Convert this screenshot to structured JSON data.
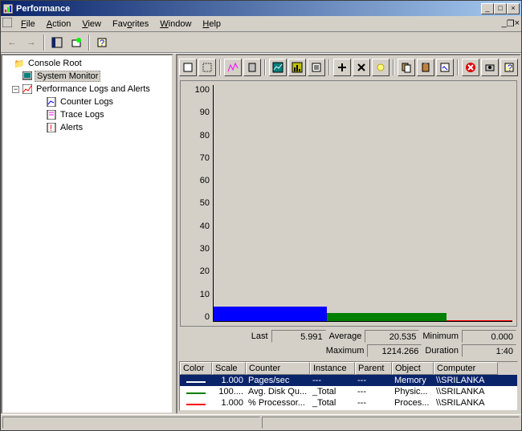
{
  "window": {
    "title": "Performance"
  },
  "menu": {
    "file": "File",
    "action": "Action",
    "view": "View",
    "favorites": "Favorites",
    "window": "Window",
    "help": "Help"
  },
  "tree": {
    "root": "Console Root",
    "system_monitor": "System Monitor",
    "perf_logs": "Performance Logs and Alerts",
    "counter_logs": "Counter Logs",
    "trace_logs": "Trace Logs",
    "alerts": "Alerts"
  },
  "chart_data": {
    "type": "bar",
    "ylim": [
      0,
      100
    ],
    "yticks": [
      "100",
      "90",
      "80",
      "70",
      "60",
      "50",
      "40",
      "30",
      "20",
      "10",
      "0"
    ],
    "series": [
      {
        "name": "Pages/sec",
        "color": "#0000ff",
        "approx_pct": 6,
        "x_start": 0,
        "x_width": 38
      },
      {
        "name": "Avg. Disk Queue Length",
        "color": "#008000",
        "approx_pct": 3.5,
        "x_start": 38,
        "x_width": 40
      },
      {
        "name": "% Processor Time",
        "color": "#ff0000",
        "approx_pct": 0.5,
        "x_start": 78,
        "x_width": 22
      }
    ]
  },
  "stats": {
    "last_label": "Last",
    "last": "5.991",
    "average_label": "Average",
    "average": "20.535",
    "minimum_label": "Minimum",
    "minimum": "0.000",
    "maximum_label": "Maximum",
    "maximum": "1214.266",
    "duration_label": "Duration",
    "duration": "1:40"
  },
  "counter_headers": {
    "color": "Color",
    "scale": "Scale",
    "counter": "Counter",
    "instance": "Instance",
    "parent": "Parent",
    "object": "Object",
    "computer": "Computer"
  },
  "counters": [
    {
      "color": "#ffffff",
      "scale": "1.000",
      "counter": "Pages/sec",
      "instance": "---",
      "parent": "---",
      "object": "Memory",
      "computer": "\\\\SRILANKA",
      "selected": true
    },
    {
      "color": "#008000",
      "scale": "100....",
      "counter": "Avg. Disk Qu...",
      "instance": "_Total",
      "parent": "---",
      "object": "Physic...",
      "computer": "\\\\SRILANKA",
      "selected": false
    },
    {
      "color": "#ff0000",
      "scale": "1.000",
      "counter": "% Processor...",
      "instance": "_Total",
      "parent": "---",
      "object": "Proces...",
      "computer": "\\\\SRILANKA",
      "selected": false
    }
  ],
  "col_widths": {
    "color": 40,
    "scale": 42,
    "counter": 80,
    "instance": 56,
    "parent": 46,
    "object": 52,
    "computer": 80
  }
}
